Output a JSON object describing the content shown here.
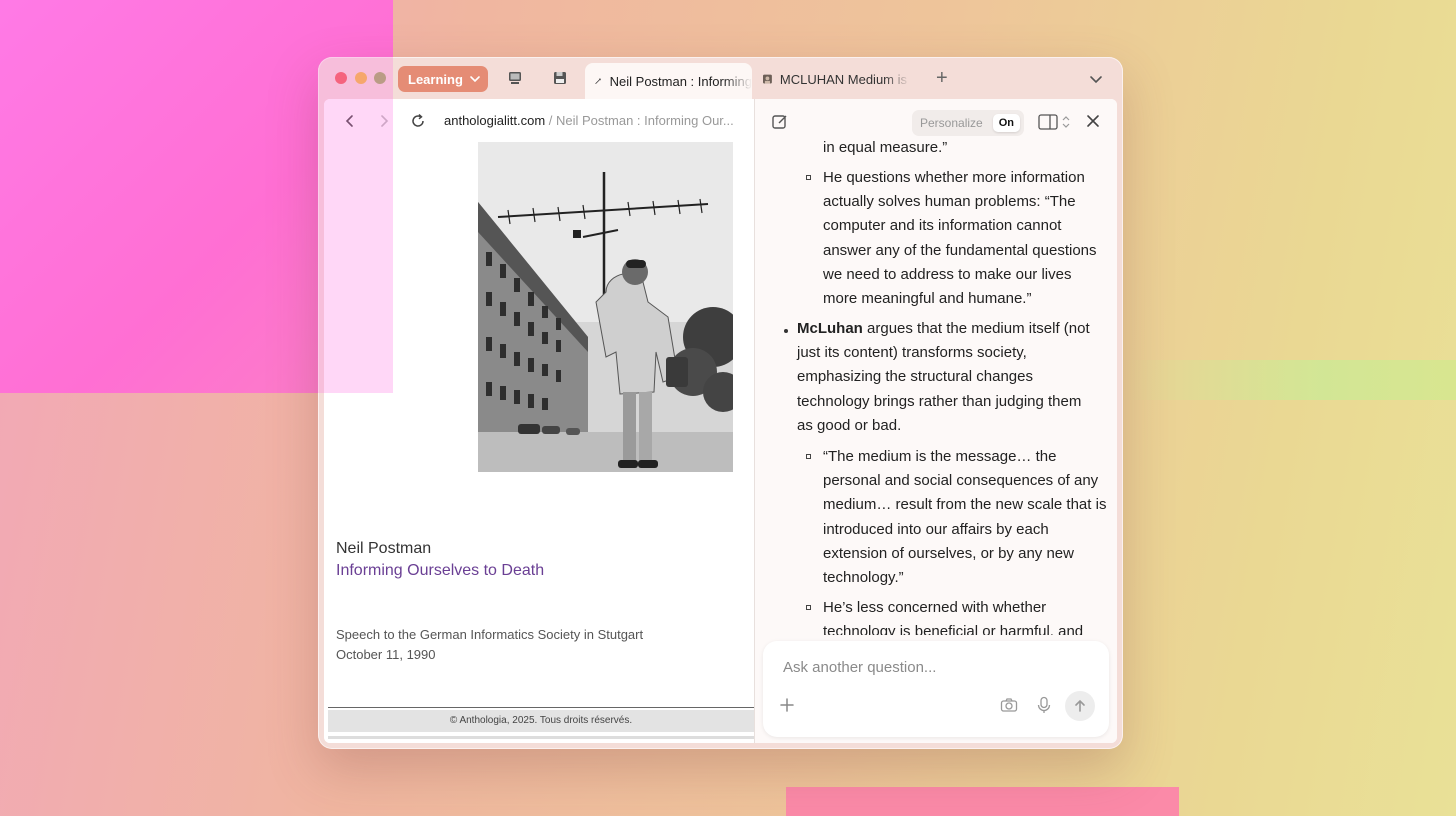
{
  "browser": {
    "space": {
      "label": "Learning"
    },
    "tabs": [
      {
        "title": "Neil Postman : Informing Ourselves to Death",
        "active": true
      },
      {
        "title": "MCLUHAN Medium is the Message",
        "active": false
      }
    ],
    "address": {
      "domain": "anthologialitt.com",
      "path": " / Neil Postman : Informing Our..."
    }
  },
  "web": {
    "author": "Neil Postman",
    "title": "Informing Ourselves to Death",
    "speech_line1": "Speech to the German Informatics Society in Stutgart",
    "speech_line2": "October 11, 1990",
    "footer": "© Anthologia, 2025. Tous droits réservés."
  },
  "assistant": {
    "personalize_label": "Personalize",
    "personalize_state": "On",
    "sub1_tail": "in equal measure.”",
    "sub2": "He questions whether more information actually solves human problems: “The computer and its information cannot answer any of the fundamental questions we need to address to make our lives more meaningful and humane.”",
    "main_bold": "McLuhan",
    "main_rest": " argues that the medium itself (not just its content) transforms society, emphasizing the structural changes technology brings rather than judging them as good or bad.",
    "sub3": "“The medium is the message… the personal and social consequences of any medium… result from the new scale that is introduced into our affairs by each extension of ourselves, or by any new technology.”",
    "sub4": "He’s less concerned with whether technology is beneficial or harmful, and",
    "ask_placeholder": "Ask another question..."
  },
  "colors": {
    "space_chip": "#e58c75",
    "title_link": "#6a3f94",
    "window_frame": "#f4ddd8"
  }
}
